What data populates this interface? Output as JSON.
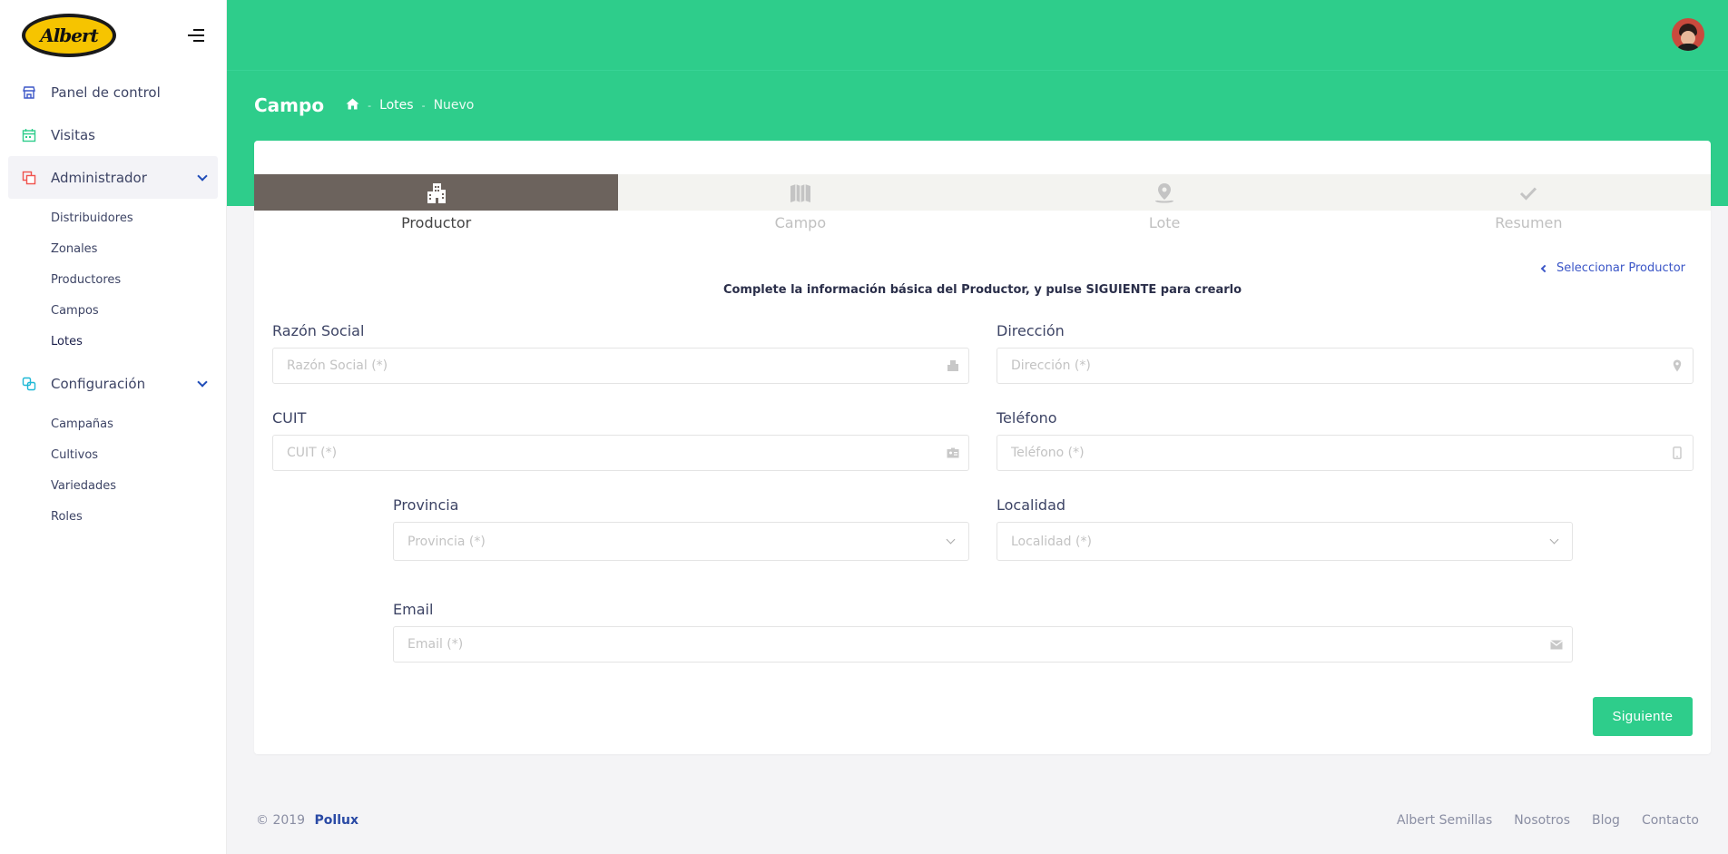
{
  "brand": {
    "logo_text": "Albert"
  },
  "sidebar": {
    "items": [
      {
        "label": "Panel de control",
        "icon": "store-icon",
        "color": "#3b56c7"
      },
      {
        "label": "Visitas",
        "icon": "calendar-icon",
        "color": "#2ecd8b"
      },
      {
        "label": "Administrador",
        "icon": "copy-icon",
        "color": "#f0524d",
        "active": true
      },
      {
        "label": "Configuración",
        "icon": "layers-icon",
        "color": "#1fb8d6"
      }
    ],
    "admin_sub": [
      "Distribuidores",
      "Zonales",
      "Productores",
      "Campos",
      "Lotes"
    ],
    "config_sub": [
      "Campañas",
      "Cultivos",
      "Variedades",
      "Roles"
    ]
  },
  "header": {
    "title": "Campo",
    "breadcrumb": [
      "Lotes",
      "Nuevo"
    ]
  },
  "wizard": {
    "steps": [
      {
        "label": "Productor",
        "icon": "building-icon",
        "active": true
      },
      {
        "label": "Campo",
        "icon": "map-icon",
        "active": false
      },
      {
        "label": "Lote",
        "icon": "map-marker-icon",
        "active": false
      },
      {
        "label": "Resumen",
        "icon": "check-icon",
        "active": false
      }
    ],
    "select_link": "Seleccionar Productor",
    "instruction": "Complete la información básica del Productor, y pulse SIGUIENTE para crearlo"
  },
  "form": {
    "razon_social": {
      "label": "Razón Social",
      "placeholder": "Razón Social (*)"
    },
    "direccion": {
      "label": "Dirección",
      "placeholder": "Dirección (*)"
    },
    "cuit": {
      "label": "CUIT",
      "placeholder": "CUIT (*)"
    },
    "telefono": {
      "label": "Teléfono",
      "placeholder": "Teléfono (*)"
    },
    "provincia": {
      "label": "Provincia",
      "placeholder": "Provincia (*)"
    },
    "localidad": {
      "label": "Localidad",
      "placeholder": "Localidad (*)"
    },
    "email": {
      "label": "Email",
      "placeholder": "Email (*)"
    },
    "next_label": "Siguiente"
  },
  "footer": {
    "copyright": "© 2019",
    "brand": "Pollux",
    "links": [
      "Albert Semillas",
      "Nosotros",
      "Blog",
      "Contacto"
    ]
  },
  "colors": {
    "primary": "#2ecd8b",
    "link": "#3b56c7",
    "step_active": "#6c635d"
  }
}
